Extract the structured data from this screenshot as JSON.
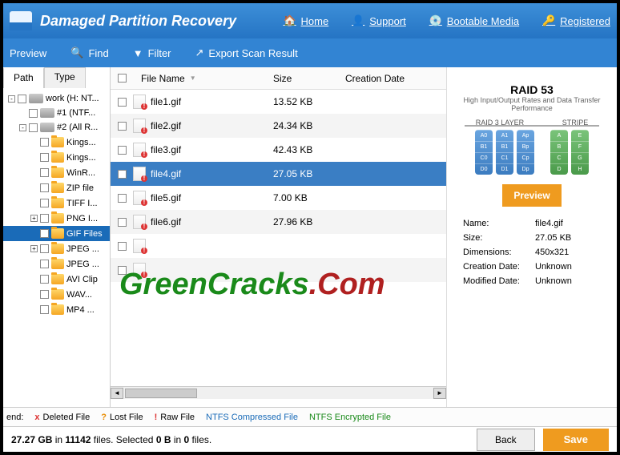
{
  "header": {
    "title": "Damaged Partition Recovery",
    "links": [
      "Home",
      "Support",
      "Bootable Media",
      "Registered"
    ]
  },
  "toolbar": {
    "preview": "Preview",
    "find": "Find",
    "filter": "Filter",
    "export": "Export Scan Result"
  },
  "sidebar": {
    "tabs": {
      "path": "Path",
      "type": "Type"
    },
    "items": [
      {
        "label": "work (H: NT...",
        "level": 1,
        "icon": "disk",
        "exp": "-"
      },
      {
        "label": "#1 (NTF...",
        "level": 2,
        "icon": "disk",
        "exp": ""
      },
      {
        "label": "#2 (All R...",
        "level": 2,
        "icon": "disk",
        "exp": "-"
      },
      {
        "label": "Kings...",
        "level": 3,
        "icon": "fold",
        "exp": ""
      },
      {
        "label": "Kings...",
        "level": 3,
        "icon": "fold",
        "exp": ""
      },
      {
        "label": "WinR...",
        "level": 3,
        "icon": "fold",
        "exp": ""
      },
      {
        "label": "ZIP file",
        "level": 3,
        "icon": "fold",
        "exp": ""
      },
      {
        "label": "TIFF I...",
        "level": 3,
        "icon": "fold",
        "exp": ""
      },
      {
        "label": "PNG I...",
        "level": 3,
        "icon": "fold",
        "exp": "+"
      },
      {
        "label": "GIF Files",
        "level": 3,
        "icon": "fold",
        "exp": "",
        "sel": true
      },
      {
        "label": "JPEG ...",
        "level": 3,
        "icon": "fold",
        "exp": "+"
      },
      {
        "label": "JPEG ...",
        "level": 3,
        "icon": "fold",
        "exp": ""
      },
      {
        "label": "AVI Clip",
        "level": 3,
        "icon": "fold",
        "exp": ""
      },
      {
        "label": "WAV...",
        "level": 3,
        "icon": "fold",
        "exp": ""
      },
      {
        "label": "MP4 ...",
        "level": 3,
        "icon": "fold",
        "exp": ""
      }
    ]
  },
  "filelist": {
    "headers": {
      "name": "File Name",
      "size": "Size",
      "date": "Creation Date"
    },
    "rows": [
      {
        "name": "file1.gif",
        "size": "13.52 KB"
      },
      {
        "name": "file2.gif",
        "size": "24.34 KB"
      },
      {
        "name": "file3.gif",
        "size": "42.43 KB"
      },
      {
        "name": "file4.gif",
        "size": "27.05 KB",
        "sel": true
      },
      {
        "name": "file5.gif",
        "size": "7.00 KB"
      },
      {
        "name": "file6.gif",
        "size": "27.96 KB"
      },
      {
        "name": "",
        "size": ""
      },
      {
        "name": "",
        "size": ""
      }
    ]
  },
  "preview": {
    "raid_title": "RAID 53",
    "raid_sub": "High Input/Output Rates and Data Transfer Performance",
    "raid_layer": "RAID 3 LAYER",
    "raid_stripe": "STRIPE",
    "btn": "Preview",
    "meta": [
      {
        "k": "Name:",
        "v": "file4.gif"
      },
      {
        "k": "Size:",
        "v": "27.05 KB"
      },
      {
        "k": "Dimensions:",
        "v": "450x321"
      },
      {
        "k": "Creation Date:",
        "v": "Unknown"
      },
      {
        "k": "Modified Date:",
        "v": "Unknown"
      }
    ]
  },
  "cylinders": [
    [
      "A0",
      "B1",
      "C0",
      "D0"
    ],
    [
      "A1",
      "B1",
      "C1",
      "D1"
    ],
    [
      "Ap",
      "Bp",
      "Cp",
      "Dp"
    ],
    [
      "A",
      "B",
      "C",
      "D"
    ],
    [
      "E",
      "F",
      "G",
      "H"
    ]
  ],
  "legend": {
    "label": "end:",
    "items": [
      "Deleted File",
      "Lost File",
      "Raw File",
      "NTFS Compressed File",
      "NTFS Encrypted File"
    ]
  },
  "status": {
    "text_prefix": "27.27 GB",
    "text_mid1": " in ",
    "text_files": "11142",
    "text_mid2": " files. Selected ",
    "text_sel": "0 B",
    "text_mid3": " in ",
    "text_selfiles": "0",
    "text_end": " files.",
    "back": "Back",
    "save": "Save"
  },
  "watermark": {
    "g": "GreenCracks",
    "d": ".Com"
  }
}
